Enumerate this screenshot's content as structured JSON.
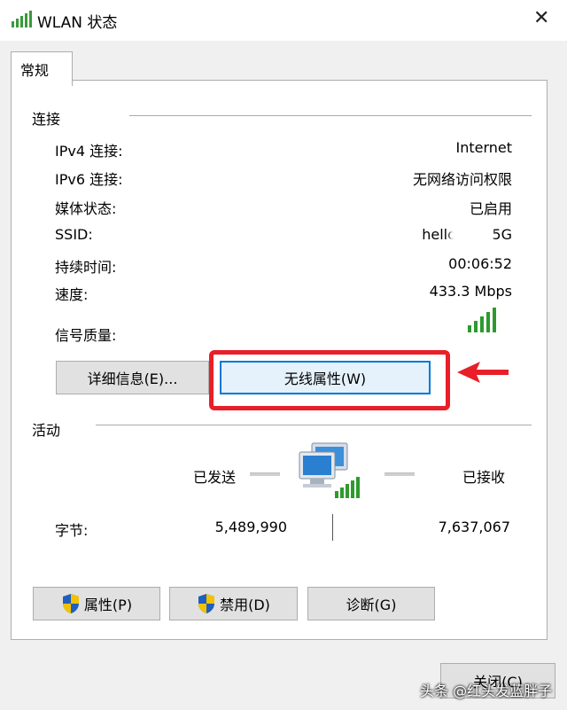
{
  "window": {
    "title": "WLAN 状态",
    "close_glyph": "✕"
  },
  "tab": {
    "label": "常规"
  },
  "connection": {
    "heading": "连接",
    "rows": [
      {
        "label": "IPv4 连接:",
        "value": "Internet"
      },
      {
        "label": "IPv6 连接:",
        "value": "无网络访问权限"
      },
      {
        "label": "媒体状态:",
        "value": "已启用"
      },
      {
        "label": "SSID:",
        "value": "hello-v     5G"
      },
      {
        "label": "持续时间:",
        "value": "00:06:52"
      },
      {
        "label": "速度:",
        "value": "433.3 Mbps"
      }
    ],
    "signal_label": "信号质量:",
    "signal_level": 5,
    "details_button": "详细信息(E)...",
    "wireless_button": "无线属性(W)"
  },
  "activity": {
    "heading": "活动",
    "sent_label": "已发送",
    "received_label": "已接收",
    "bytes_label": "字节:",
    "sent_bytes": "5,489,990",
    "received_bytes": "7,637,067"
  },
  "buttons": {
    "properties": "属性(P)",
    "disable": "禁用(D)",
    "diagnose": "诊断(G)",
    "close": "关闭(C)"
  },
  "watermark": "头条 @红头发蓝胖子",
  "colors": {
    "highlight": "#e81f28",
    "signal": "#2e9a2e",
    "focus": "#0078d7"
  }
}
